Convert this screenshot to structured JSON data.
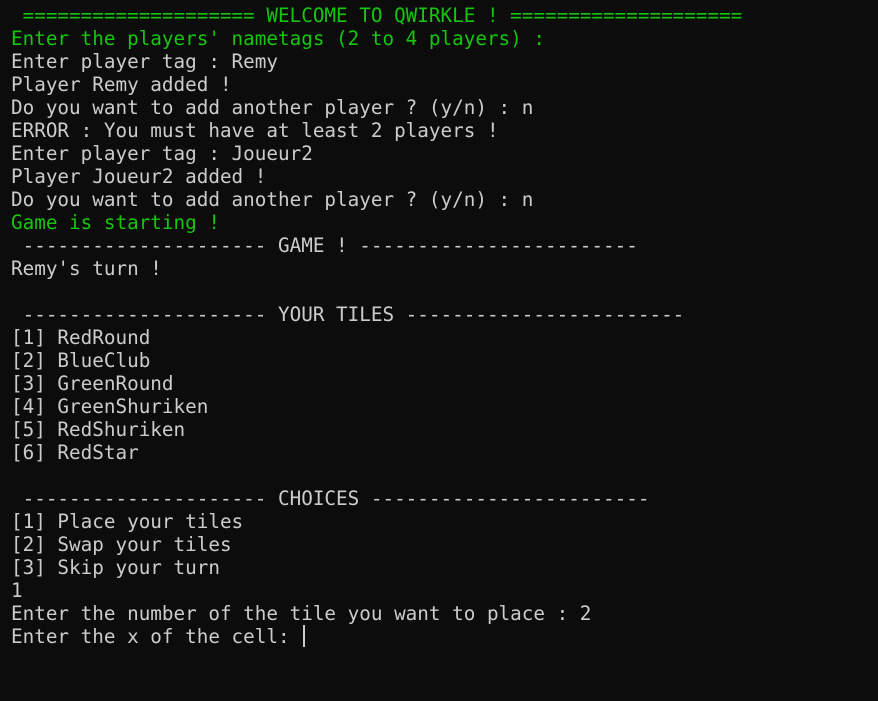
{
  "lines": [
    {
      "text": " ==================== WELCOME TO QWIRKLE ! ====================",
      "color": "green"
    },
    {
      "text": "Enter the players' nametags (2 to 4 players) :",
      "color": "green"
    },
    {
      "text": "Enter player tag : Remy",
      "color": "default"
    },
    {
      "text": "Player Remy added !",
      "color": "default"
    },
    {
      "text": "Do you want to add another player ? (y/n) : n",
      "color": "default"
    },
    {
      "text": "ERROR : You must have at least 2 players !",
      "color": "default"
    },
    {
      "text": "Enter player tag : Joueur2",
      "color": "default"
    },
    {
      "text": "Player Joueur2 added !",
      "color": "default"
    },
    {
      "text": "Do you want to add another player ? (y/n) : n",
      "color": "default"
    },
    {
      "text": "Game is starting !",
      "color": "green"
    },
    {
      "text": " --------------------- GAME ! ------------------------",
      "color": "default"
    },
    {
      "text": "Remy's turn !",
      "color": "default"
    },
    {
      "text": "",
      "color": "default"
    },
    {
      "text": " --------------------- YOUR TILES ------------------------",
      "color": "default"
    },
    {
      "text": "[1] RedRound",
      "color": "default"
    },
    {
      "text": "[2] BlueClub",
      "color": "default"
    },
    {
      "text": "[3] GreenRound",
      "color": "default"
    },
    {
      "text": "[4] GreenShuriken",
      "color": "default"
    },
    {
      "text": "[5] RedShuriken",
      "color": "default"
    },
    {
      "text": "[6] RedStar",
      "color": "default"
    },
    {
      "text": "",
      "color": "default"
    },
    {
      "text": " --------------------- CHOICES ------------------------",
      "color": "default"
    },
    {
      "text": "[1] Place your tiles",
      "color": "default"
    },
    {
      "text": "[2] Swap your tiles",
      "color": "default"
    },
    {
      "text": "[3] Skip your turn",
      "color": "default"
    },
    {
      "text": "1",
      "color": "default"
    },
    {
      "text": "Enter the number of the tile you want to place : 2",
      "color": "default"
    },
    {
      "text": "Enter the x of the cell: ",
      "color": "default"
    }
  ],
  "colors": {
    "background": "#0c0c0c",
    "default": "#cccccc",
    "green": "#16c60c"
  }
}
